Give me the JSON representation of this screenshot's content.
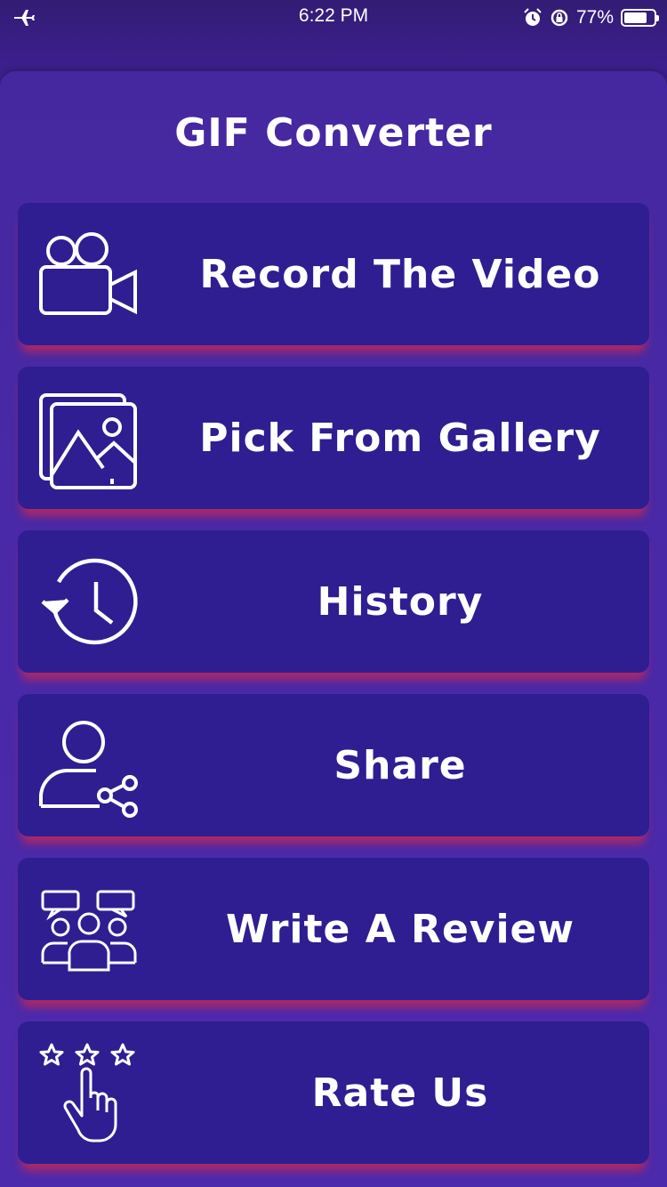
{
  "status_bar": {
    "time": "6:22 PM",
    "battery_percent": "77%",
    "battery_level": 0.77,
    "icons": [
      "airplane-icon",
      "alarm-icon",
      "rotation-lock-icon",
      "battery-icon"
    ]
  },
  "app": {
    "title": "GIF Converter",
    "colors": {
      "background": "#4528a0",
      "button": "#2f1d92",
      "button_shadow": "#be285a",
      "text": "#ffffff"
    }
  },
  "menu": [
    {
      "label": "Record The Video",
      "icon": "video-camera-icon"
    },
    {
      "label": "Pick From Gallery",
      "icon": "gallery-icon"
    },
    {
      "label": "History",
      "icon": "history-icon"
    },
    {
      "label": "Share",
      "icon": "share-user-icon"
    },
    {
      "label": "Write A Review",
      "icon": "review-people-icon"
    },
    {
      "label": "Rate Us",
      "icon": "rate-stars-icon"
    }
  ]
}
